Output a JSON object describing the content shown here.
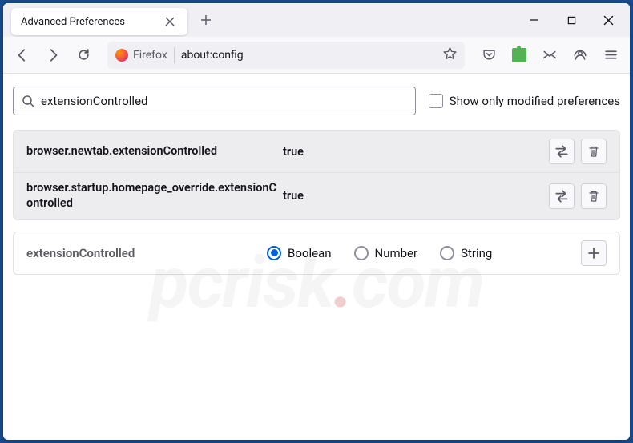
{
  "tab": {
    "title": "Advanced Preferences"
  },
  "identity": {
    "label": "Firefox"
  },
  "url": "about:config",
  "search": {
    "value": "extensionControlled"
  },
  "showModified": {
    "label": "Show only modified preferences"
  },
  "prefs": [
    {
      "name": "browser.newtab.extensionControlled",
      "value": "true"
    },
    {
      "name": "browser.startup.homepage_override.extensionControlled",
      "value": "true"
    }
  ],
  "add": {
    "name": "extensionControlled",
    "options": {
      "boolean": "Boolean",
      "number": "Number",
      "string": "String"
    }
  },
  "watermark": {
    "left": "pcrisk",
    "right": "com"
  }
}
